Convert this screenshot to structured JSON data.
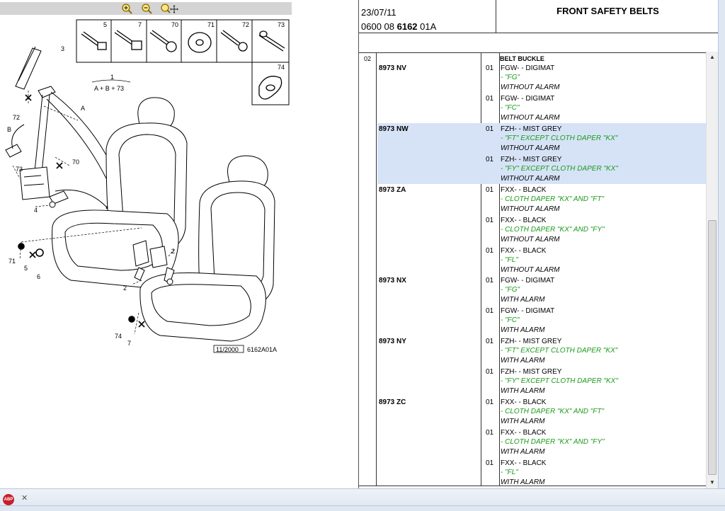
{
  "zoom_toolbar": {
    "zoom_in": "zoom-in",
    "zoom_out": "zoom-out",
    "zoom_pan": "zoom-pan"
  },
  "drawing": {
    "parts_box": [
      "5",
      "7",
      "70",
      "71",
      "72",
      "73",
      "74"
    ],
    "callouts": [
      "3",
      "72",
      "A",
      "B",
      "73",
      "70",
      "4",
      "71",
      "5",
      "6",
      "2",
      "2",
      "74",
      "7"
    ],
    "kit_number": "1",
    "kit_formula": "A + B + 73",
    "footer_date": "11/2000",
    "footer_ref": "6162A01A"
  },
  "header": {
    "date": "23/07/11",
    "ref_prefix": "0600 08 ",
    "ref_bold": "6162",
    "ref_suffix": " 01A",
    "title": "FRONT SAFETY BELTS"
  },
  "list": {
    "group": "02",
    "section": "BELT BUCKLE",
    "refs": [
      {
        "code": "8973 NV",
        "items": [
          {
            "qty": "01",
            "name": "FGW- - DIGIMAT",
            "cond": "- \"FG\"",
            "alarm": "WITHOUT ALARM"
          },
          {
            "qty": "01",
            "name": "FGW- - DIGIMAT",
            "cond": "- \"FC\"",
            "alarm": "WITHOUT ALARM"
          }
        ]
      },
      {
        "code": "8973 NW",
        "highlight": true,
        "items": [
          {
            "qty": "01",
            "name": "FZH- - MIST GREY",
            "cond": "- \"FT\" EXCEPT CLOTH DAPER \"KX\"",
            "alarm": "WITHOUT ALARM"
          },
          {
            "qty": "01",
            "name": "FZH- - MIST GREY",
            "cond": "- \"FY\" EXCEPT CLOTH DAPER \"KX\"",
            "alarm": "WITHOUT ALARM"
          }
        ]
      },
      {
        "code": "8973 ZA",
        "items": [
          {
            "qty": "01",
            "name": "FXX- - BLACK",
            "cond": "- CLOTH DAPER \"KX\" AND \"FT\"",
            "alarm": "WITHOUT ALARM"
          },
          {
            "qty": "01",
            "name": "FXX- - BLACK",
            "cond": "- CLOTH DAPER \"KX\" AND \"FY\"",
            "alarm": "WITHOUT ALARM"
          },
          {
            "qty": "01",
            "name": "FXX- - BLACK",
            "cond": "- \"FL\"",
            "alarm": "WITHOUT ALARM"
          }
        ]
      },
      {
        "code": "8973 NX",
        "items": [
          {
            "qty": "01",
            "name": "FGW- - DIGIMAT",
            "cond": "- \"FG\"",
            "alarm": "WITH ALARM"
          },
          {
            "qty": "01",
            "name": "FGW- - DIGIMAT",
            "cond": "- \"FC\"",
            "alarm": "WITH ALARM"
          }
        ]
      },
      {
        "code": "8973 NY",
        "items": [
          {
            "qty": "01",
            "name": "FZH- - MIST GREY",
            "cond": "- \"FT\" EXCEPT CLOTH DAPER \"KX\"",
            "alarm": "WITH ALARM"
          },
          {
            "qty": "01",
            "name": "FZH- - MIST GREY",
            "cond": "- \"FY\" EXCEPT CLOTH DAPER \"KX\"",
            "alarm": "WITH ALARM"
          }
        ]
      },
      {
        "code": "8973 ZC",
        "items": [
          {
            "qty": "01",
            "name": "FXX- - BLACK",
            "cond": "- CLOTH DAPER \"KX\" AND \"FT\"",
            "alarm": "WITH ALARM"
          },
          {
            "qty": "01",
            "name": "FXX- - BLACK",
            "cond": "- CLOTH DAPER \"KX\" AND \"FY\"",
            "alarm": "WITH ALARM"
          },
          {
            "qty": "01",
            "name": "FXX- - BLACK",
            "cond": "- \"FL\"",
            "alarm": "WITH ALARM"
          }
        ]
      }
    ]
  },
  "colors": {
    "highlight": "#d6e3f7",
    "condition_text": "#1a9a1a",
    "zoom_bar": "#d4d4d4"
  },
  "bottom_bar": {
    "adblock_icon": "ABP",
    "close_icon": "✕"
  }
}
